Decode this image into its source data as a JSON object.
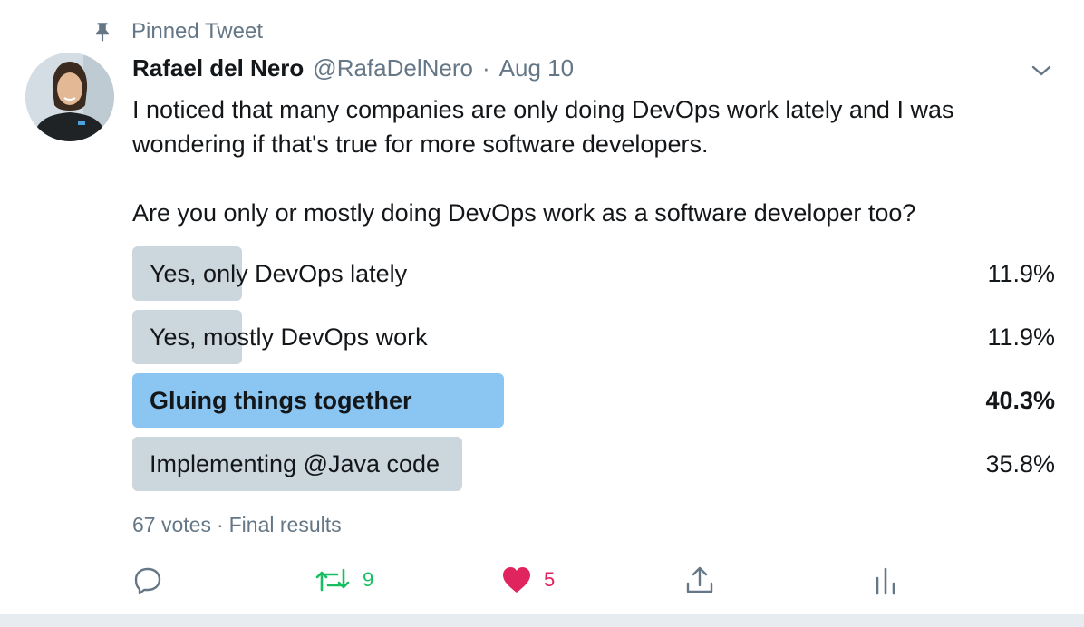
{
  "pinned": {
    "label": "Pinned Tweet",
    "icon": "pin-icon"
  },
  "author": {
    "name": "Rafael del Nero",
    "handle": "@RafaDelNero",
    "separator": "·",
    "date": "Aug 10",
    "avatar": "avatar-photo"
  },
  "menu": {
    "icon": "chevron-down-icon"
  },
  "tweet": {
    "paragraph1": "I noticed that many companies are only doing DevOps work lately and I was wondering if that's true for more software developers.",
    "paragraph2": "Are you only or mostly doing DevOps work as a software developer too?"
  },
  "poll": {
    "options": [
      {
        "label": "Yes, only DevOps lately",
        "percent": "11.9%",
        "value": 11.9,
        "winner": false
      },
      {
        "label": "Yes, mostly DevOps work",
        "percent": "11.9%",
        "value": 11.9,
        "winner": false
      },
      {
        "label": "Gluing things together",
        "percent": "40.3%",
        "value": 40.3,
        "winner": true
      },
      {
        "label": "Implementing @Java code",
        "percent": "35.8%",
        "value": 35.8,
        "winner": false
      }
    ],
    "votes": "67 votes",
    "separator": "·",
    "status": "Final results"
  },
  "actions": {
    "reply": {
      "icon": "reply-icon"
    },
    "retweet": {
      "icon": "retweet-icon",
      "count": "9",
      "color": "#17bf63"
    },
    "like": {
      "icon": "heart-icon",
      "count": "5",
      "color": "#e0245e",
      "liked": true
    },
    "share": {
      "icon": "share-icon"
    },
    "analytics": {
      "icon": "analytics-icon"
    }
  },
  "colors": {
    "text": "#14171a",
    "secondary": "#657786",
    "bar_default": "#ccd6dd",
    "bar_winner": "#8ac6f1",
    "background": "#ffffff",
    "divider": "#e6ecf0"
  }
}
